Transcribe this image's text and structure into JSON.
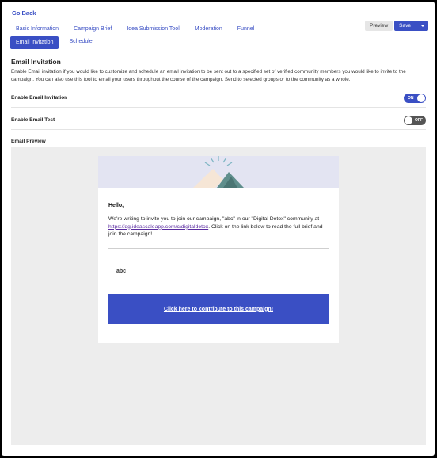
{
  "nav": {
    "go_back": "Go Back"
  },
  "tabs": {
    "row1": [
      "Basic Information",
      "Campaign Brief",
      "Idea Submission Tool",
      "Moderation",
      "Funnel"
    ],
    "row2": [
      "Email Invitation",
      "Schedule"
    ],
    "active": "Email Invitation"
  },
  "actions": {
    "preview": "Preview",
    "save": "Save"
  },
  "section": {
    "title": "Email Invitation",
    "description": "Enable Email invitation if you would like to customize and schedule an email invitation to be sent out to a specified set of verified community members you would like to invite to the campaign. You can also use this tool to email your users throughout the course of the campaign. Send to selected groups or to the community as a whole."
  },
  "settings": {
    "enable_invitation": {
      "label": "Enable Email Invitation",
      "state": "ON"
    },
    "enable_test": {
      "label": "Enable Email Test",
      "state": "OFF"
    }
  },
  "preview": {
    "label": "Email Preview"
  },
  "email": {
    "greeting": "Hello,",
    "body_before_link": "We're writing to invite you to join our campaign, \"abc\" in our \"Digital Detox\" community at ",
    "link": "https://dg.ideascaleapp.com/c/digitaldetox",
    "body_after_link": ". Click on the link below to read the full brief and join the campaign!",
    "campaign_name": "abc",
    "cta": "Click here to contribute to this campaign!"
  },
  "colors": {
    "accent": "#3a4fc4",
    "banner": "#e3e4f2",
    "preview_bg": "#ededed",
    "link": "#5a2ca0"
  }
}
